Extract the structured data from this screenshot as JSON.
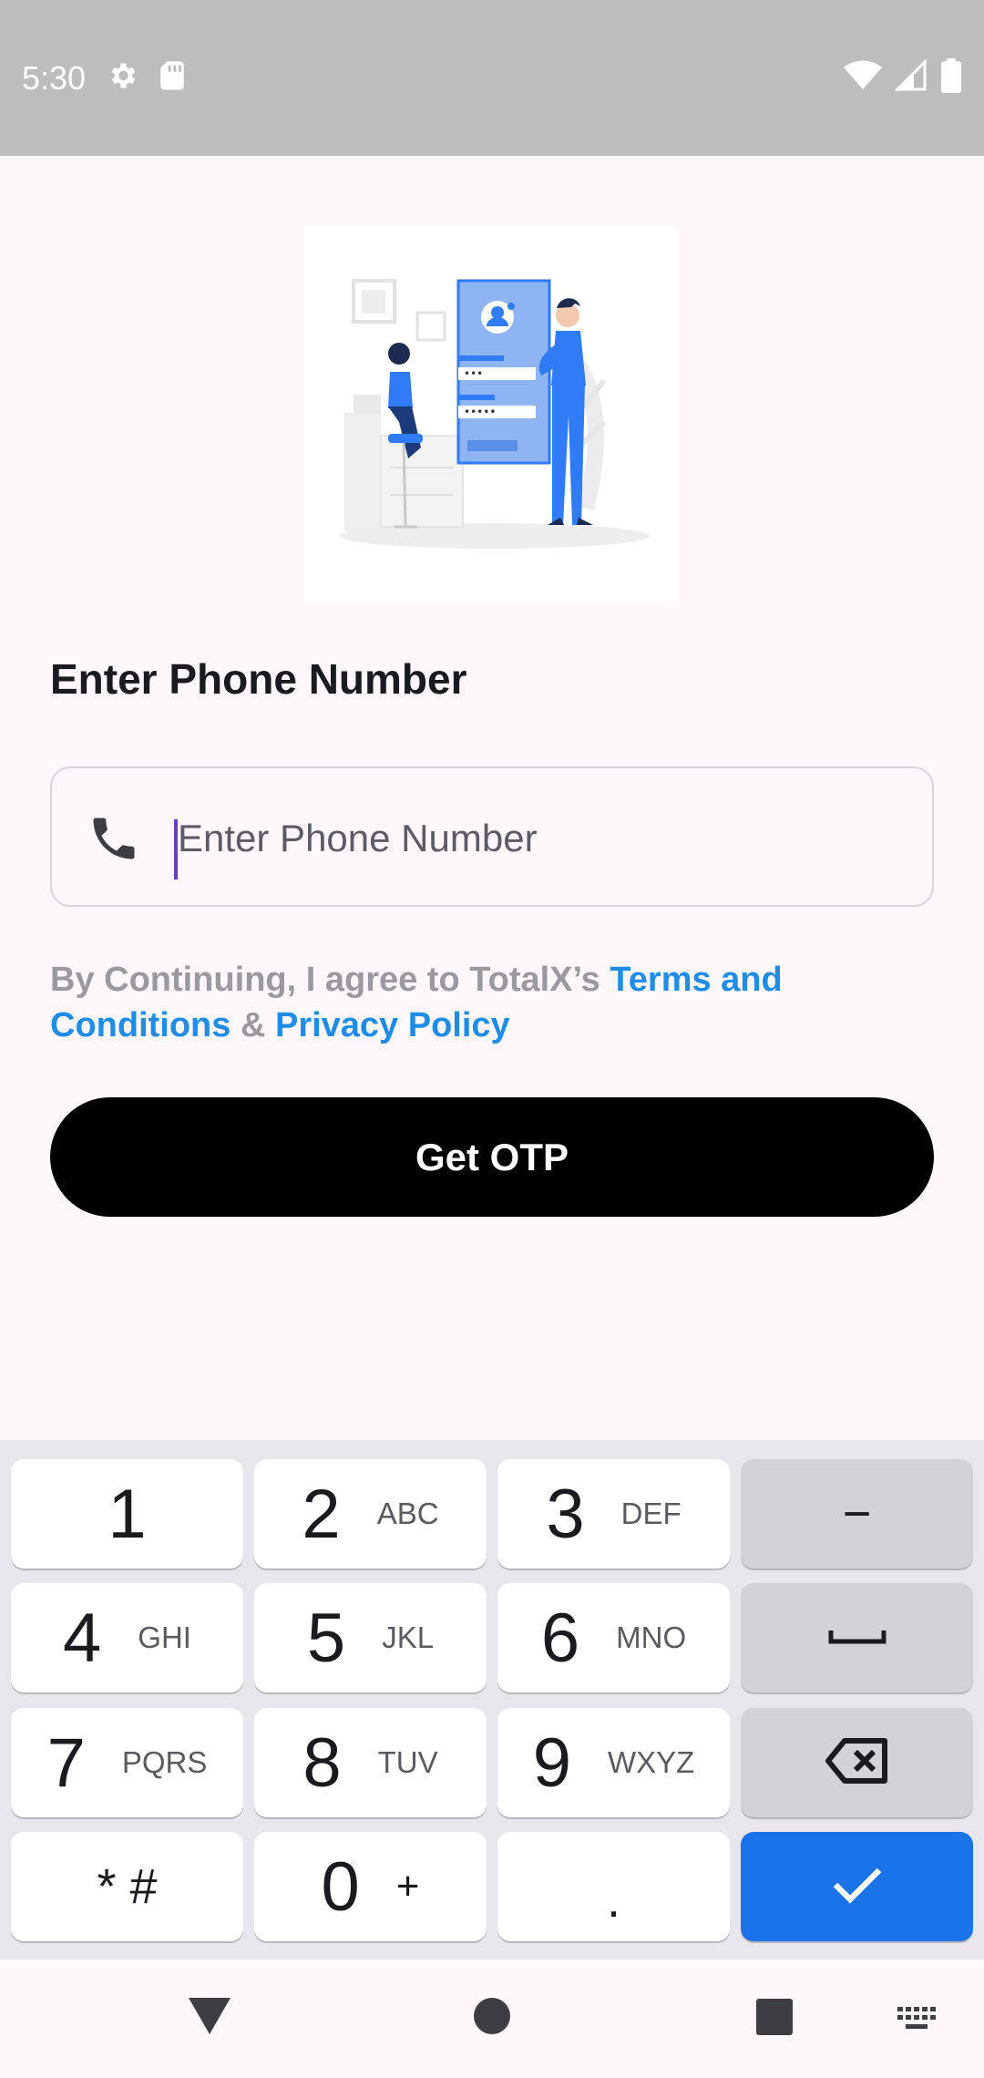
{
  "status_bar": {
    "time": "5:30",
    "icons": [
      "gear-icon",
      "sd-card-icon",
      "wifi-icon",
      "signal-icon",
      "battery-icon"
    ]
  },
  "heading": "Enter Phone Number",
  "phone_field": {
    "placeholder": "Enter Phone Number",
    "value": "",
    "icon": "phone-icon"
  },
  "terms": {
    "prefix": "By Continuing, I agree to TotalX’s ",
    "terms_link": "Terms and Conditions",
    "joiner": " & ",
    "privacy_link": "Privacy Policy"
  },
  "otp_button": "Get OTP",
  "keyboard": {
    "keys": [
      {
        "digit": "1",
        "letters": ""
      },
      {
        "digit": "2",
        "letters": "ABC"
      },
      {
        "digit": "3",
        "letters": "DEF"
      },
      {
        "digit": "4",
        "letters": "GHI"
      },
      {
        "digit": "5",
        "letters": "JKL"
      },
      {
        "digit": "6",
        "letters": "MNO"
      },
      {
        "digit": "7",
        "letters": "PQRS"
      },
      {
        "digit": "8",
        "letters": "TUV"
      },
      {
        "digit": "9",
        "letters": "WXYZ"
      },
      {
        "digit": "0",
        "letters": "+"
      }
    ],
    "star_hash": "* #",
    "dot": ".",
    "minus": "−"
  },
  "colors": {
    "accent": "#1f8ce6",
    "enter_key": "#1a73e8",
    "button": "#000000",
    "background": "#fdf7fb"
  }
}
